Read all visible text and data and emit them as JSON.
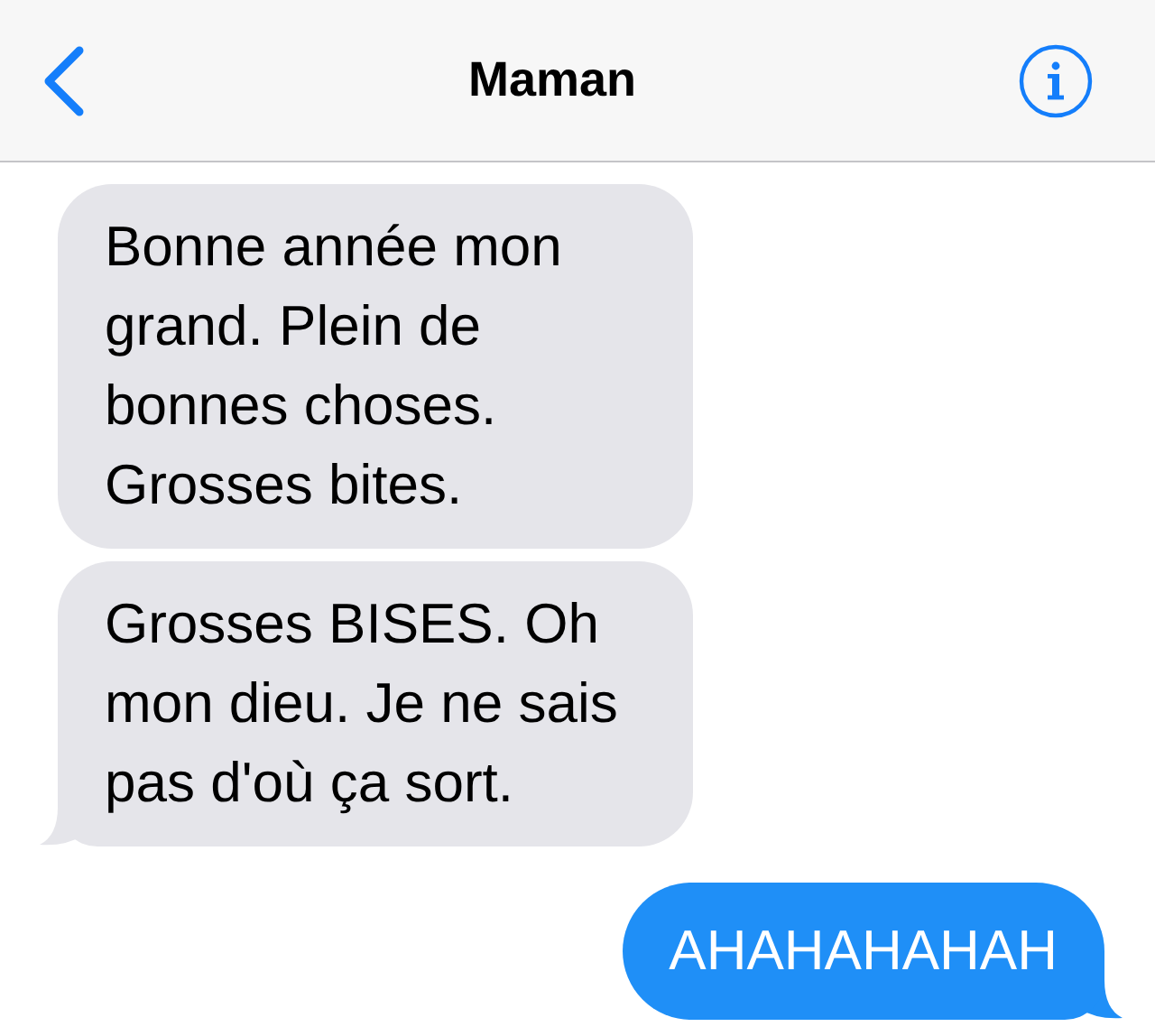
{
  "header": {
    "title": "Maman"
  },
  "messages": [
    {
      "kind": "incoming",
      "text": "Bonne année mon grand. Plein de bonnes choses. Grosses bites.",
      "tail": false
    },
    {
      "kind": "incoming",
      "text": "Grosses BISES. Oh mon dieu. Je ne sais pas d'où ça sort.",
      "tail": true
    },
    {
      "kind": "outgoing",
      "text": "AHAHAHAHAH",
      "tail": true
    }
  ]
}
